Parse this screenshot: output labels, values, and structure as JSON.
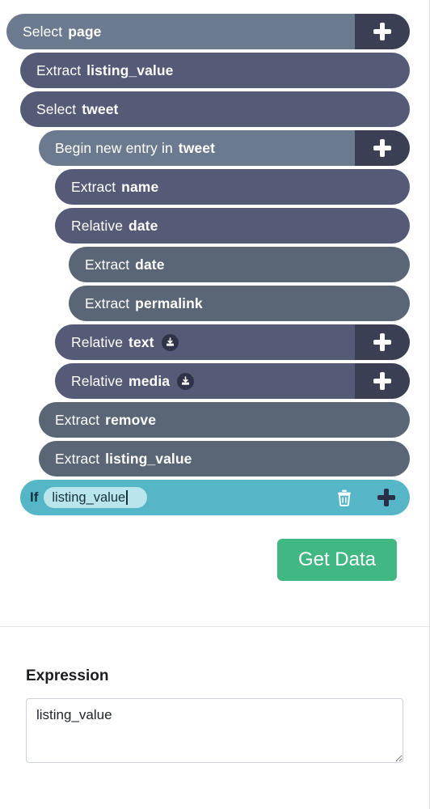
{
  "program": {
    "steps": [
      {
        "verb": "Select",
        "arg": "page",
        "indent": 0,
        "tone": "slate-blue",
        "has_plus": true,
        "plus_label": "+",
        "download": false
      },
      {
        "verb": "Extract",
        "arg": "listing_value",
        "indent": 1,
        "tone": "violet-gray",
        "has_plus": false,
        "download": false
      },
      {
        "verb": "Select",
        "arg": "tweet",
        "indent": 1,
        "tone": "violet-gray",
        "has_plus": false,
        "download": false
      },
      {
        "verb": "Begin new entry in",
        "arg": "tweet",
        "indent": 2,
        "tone": "slate-blue",
        "has_plus": true,
        "plus_label": "+",
        "download": false
      },
      {
        "verb": "Extract",
        "arg": "name",
        "indent": 3,
        "tone": "violet-gray",
        "has_plus": false,
        "download": false
      },
      {
        "verb": "Relative",
        "arg": "date",
        "indent": 3,
        "tone": "violet-gray",
        "has_plus": false,
        "download": false
      },
      {
        "verb": "Extract",
        "arg": "date",
        "indent": 4,
        "tone": "slate-gray",
        "has_plus": false,
        "download": false
      },
      {
        "verb": "Extract",
        "arg": "permalink",
        "indent": 4,
        "tone": "slate-gray",
        "has_plus": false,
        "download": false
      },
      {
        "verb": "Relative",
        "arg": "text",
        "indent": 3,
        "tone": "violet-gray",
        "has_plus": true,
        "plus_label": "+",
        "download": true
      },
      {
        "verb": "Relative",
        "arg": "media",
        "indent": 3,
        "tone": "violet-gray",
        "has_plus": true,
        "plus_label": "+",
        "download": true
      },
      {
        "verb": "Extract",
        "arg": "remove",
        "indent": 2,
        "tone": "slate-gray",
        "has_plus": false,
        "download": false
      },
      {
        "verb": "Extract",
        "arg": "listing_value",
        "indent": 2,
        "tone": "slate-gray",
        "has_plus": false,
        "download": false
      }
    ],
    "if_row": {
      "keyword": "If",
      "input_value": "listing_value",
      "indent": 1,
      "delete_icon": "trash-icon",
      "add_icon": "plus-icon"
    }
  },
  "actions": {
    "get_data_label": "Get Data"
  },
  "expression": {
    "title": "Expression",
    "value": "listing_value",
    "placeholder": ""
  },
  "colors": {
    "slate_blue": "#6b7a8f",
    "violet_gray": "#555a77",
    "slate_gray": "#5a6575",
    "plus_zone": "#3b3f54",
    "if_row": "#55b6c8",
    "if_input": "#b8e6ec",
    "get_data": "#41b883",
    "divider": "#e3e3e3"
  }
}
